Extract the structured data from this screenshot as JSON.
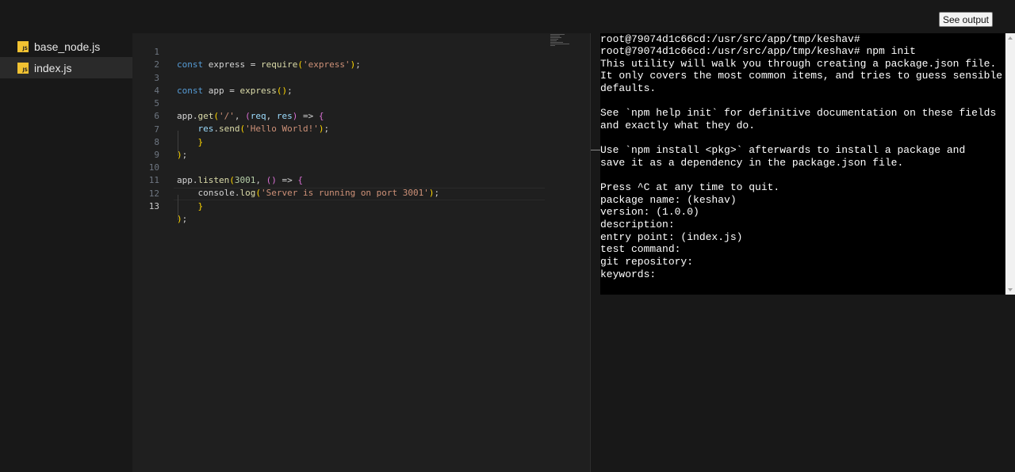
{
  "header": {
    "see_output_label": "See output"
  },
  "sidebar": {
    "files": [
      {
        "name": "base_node.js",
        "icon": "js-file-icon",
        "icon_text": "JS",
        "active": false
      },
      {
        "name": "index.js",
        "icon": "js-file-icon",
        "icon_text": "JS",
        "active": true
      }
    ]
  },
  "editor": {
    "active_line": 13,
    "line_numbers": [
      "1",
      "2",
      "3",
      "4",
      "5",
      "6",
      "7",
      "8",
      "9",
      "10",
      "11",
      "12",
      "13"
    ],
    "lines": [
      "const express = require('express');",
      "",
      "const app = express();",
      "",
      "app.get('/', (req, res) => {",
      "    res.send('Hello World!');",
      "    }",
      ");",
      "",
      "app.listen(3001, () => {",
      "    console.log('Server is running on port 3001');",
      "    }",
      ");"
    ]
  },
  "terminal": {
    "lines": [
      "root@79074d1c66cd:/usr/src/app/tmp/keshav#",
      "root@79074d1c66cd:/usr/src/app/tmp/keshav# npm init",
      "This utility will walk you through creating a package.json file.",
      "It only covers the most common items, and tries to guess sensible",
      "defaults.",
      "",
      "See `npm help init` for definitive documentation on these fields",
      "and exactly what they do.",
      "",
      "Use `npm install <pkg>` afterwards to install a package and",
      "save it as a dependency in the package.json file.",
      "",
      "Press ^C at any time to quit.",
      "package name: (keshav)",
      "version: (1.0.0)",
      "description:",
      "entry point: (index.js)",
      "test command:",
      "git repository:",
      "keywords:"
    ]
  },
  "colors": {
    "background": "#181818",
    "editor_bg": "#1f1f1f",
    "terminal_bg": "#000000",
    "js_icon": "#f1c232",
    "keyword": "#569cd6",
    "string": "#ce9178",
    "function": "#dcdcaa",
    "bracket_gold": "#ffd700",
    "bracket_purple": "#da70d6",
    "bracket_blue": "#179fff"
  }
}
